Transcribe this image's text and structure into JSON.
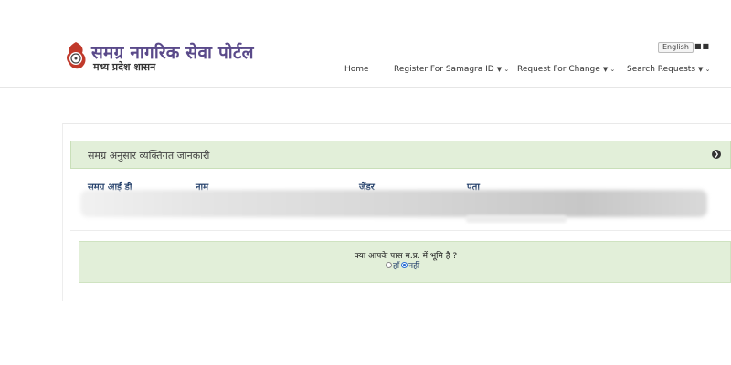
{
  "header": {
    "brand_title": "समग्र नागरिक सेवा पोर्टल",
    "brand_subtitle": "मध्य प्रदेश शासन",
    "language_button": "English",
    "nav": {
      "home": "Home",
      "register": "Register For Samagra ID",
      "change": "Request For Change",
      "search": "Search Requests"
    }
  },
  "panel": {
    "title": "समग्र अनुसार व्यक्तिगत जानकारी",
    "columns": [
      "समग्र आई डी",
      "नाम",
      "जेंडर",
      "पता"
    ]
  },
  "question": {
    "text": "क्या आपके पास म.प्र. में भूमि है ?",
    "options": [
      "हाँ",
      "नहीं"
    ],
    "selected": "नहीं"
  },
  "colors": {
    "panel_bg": "#e2efd9",
    "header_text": "#24406b",
    "brand": "#5a4a8a"
  }
}
